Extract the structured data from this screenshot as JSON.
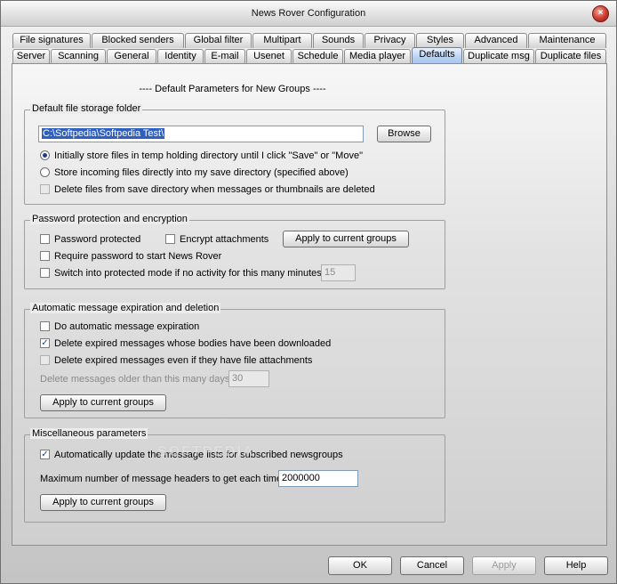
{
  "window": {
    "title": "News Rover Configuration",
    "close_glyph": "×"
  },
  "tabs_row1": [
    {
      "label": "File signatures"
    },
    {
      "label": "Blocked senders"
    },
    {
      "label": "Global filter"
    },
    {
      "label": "Multipart"
    },
    {
      "label": "Sounds"
    },
    {
      "label": "Privacy"
    },
    {
      "label": "Styles"
    },
    {
      "label": "Advanced"
    },
    {
      "label": "Maintenance"
    }
  ],
  "tabs_row2": [
    {
      "label": "Server"
    },
    {
      "label": "Scanning"
    },
    {
      "label": "General"
    },
    {
      "label": "Identity"
    },
    {
      "label": "E-mail"
    },
    {
      "label": "Usenet"
    },
    {
      "label": "Schedule"
    },
    {
      "label": "Media player"
    },
    {
      "label": "Defaults",
      "active": true
    },
    {
      "label": "Duplicate msg"
    },
    {
      "label": "Duplicate files"
    }
  ],
  "page": {
    "heading": "----  Default Parameters for New Groups  ----"
  },
  "storage": {
    "legend": "Default file storage folder",
    "folder_value": "C:\\Softpedia\\Softpedia Test\\",
    "browse_label": "Browse",
    "opt_temp_label": "Initially store files in temp holding directory until I click \"Save\" or \"Move\"",
    "opt_temp_selected": true,
    "opt_direct_label": "Store incoming files directly into my save directory (specified above)",
    "opt_direct_selected": false,
    "delete_label": "Delete files from save directory when messages or thumbnails are deleted",
    "delete_checked": false
  },
  "password": {
    "legend": "Password protection and encryption",
    "protected_label": "Password protected",
    "encrypt_label": "Encrypt attachments",
    "apply_label": "Apply to current groups",
    "require_label": "Require password to start News Rover",
    "switch_label": "Switch into protected mode if no activity for this many minutes:",
    "minutes_value": "15"
  },
  "expiration": {
    "legend": "Automatic message expiration and deletion",
    "auto_label": "Do automatic message expiration",
    "auto_checked": false,
    "expired_label": "Delete expired messages whose bodies have been downloaded",
    "expired_checked": true,
    "attach_label": "Delete expired messages even if they have file attachments",
    "older_label": "Delete messages older than this many days:",
    "days_value": "30",
    "apply_label": "Apply to current groups"
  },
  "misc": {
    "legend": "Miscellaneous parameters",
    "update_label": "Automatically update the message lists for subscribed newsgroups",
    "update_checked": true,
    "max_headers_label": "Maximum number of message headers to get each time:",
    "max_headers_value": "2000000",
    "apply_label": "Apply to current groups",
    "watermark": "SOFTPEDIA"
  },
  "buttons": {
    "ok": "OK",
    "cancel": "Cancel",
    "apply": "Apply",
    "help": "Help"
  },
  "check_glyph": "✓"
}
